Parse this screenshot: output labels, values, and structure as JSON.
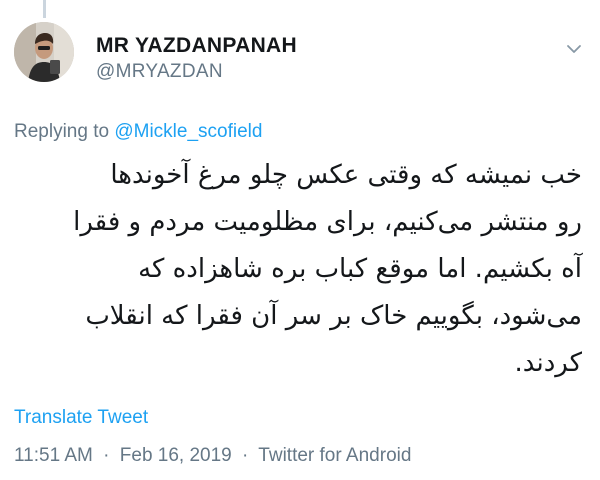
{
  "tweet": {
    "author": {
      "display_name": "MR YAZDANPANAH",
      "handle": "@MRYAZDAN"
    },
    "menu_icon": "chevron-down-icon",
    "reply": {
      "prefix": "Replying to",
      "mention": "@Mickle_scofield"
    },
    "text": "خب نمیشه که وقتی عکس چلو مرغ آخوندها\nرو منتشر می‌کنیم، برای مظلومیت مردم و فقرا\nآه بکشیم. اما موقع کباب بره شاهزاده که\nمی‌شود، بگوییم خاک بر سر آن فقرا که انقلاب\nکردند.",
    "translate_label": "Translate Tweet",
    "meta": {
      "time": "11:51 AM",
      "separator": "·",
      "date": "Feb 16, 2019",
      "source": "Twitter for Android"
    }
  },
  "colors": {
    "link": "#1da1f2",
    "secondary_text": "#657786",
    "primary_text": "#14171a",
    "thread_line": "#cbd5de"
  }
}
